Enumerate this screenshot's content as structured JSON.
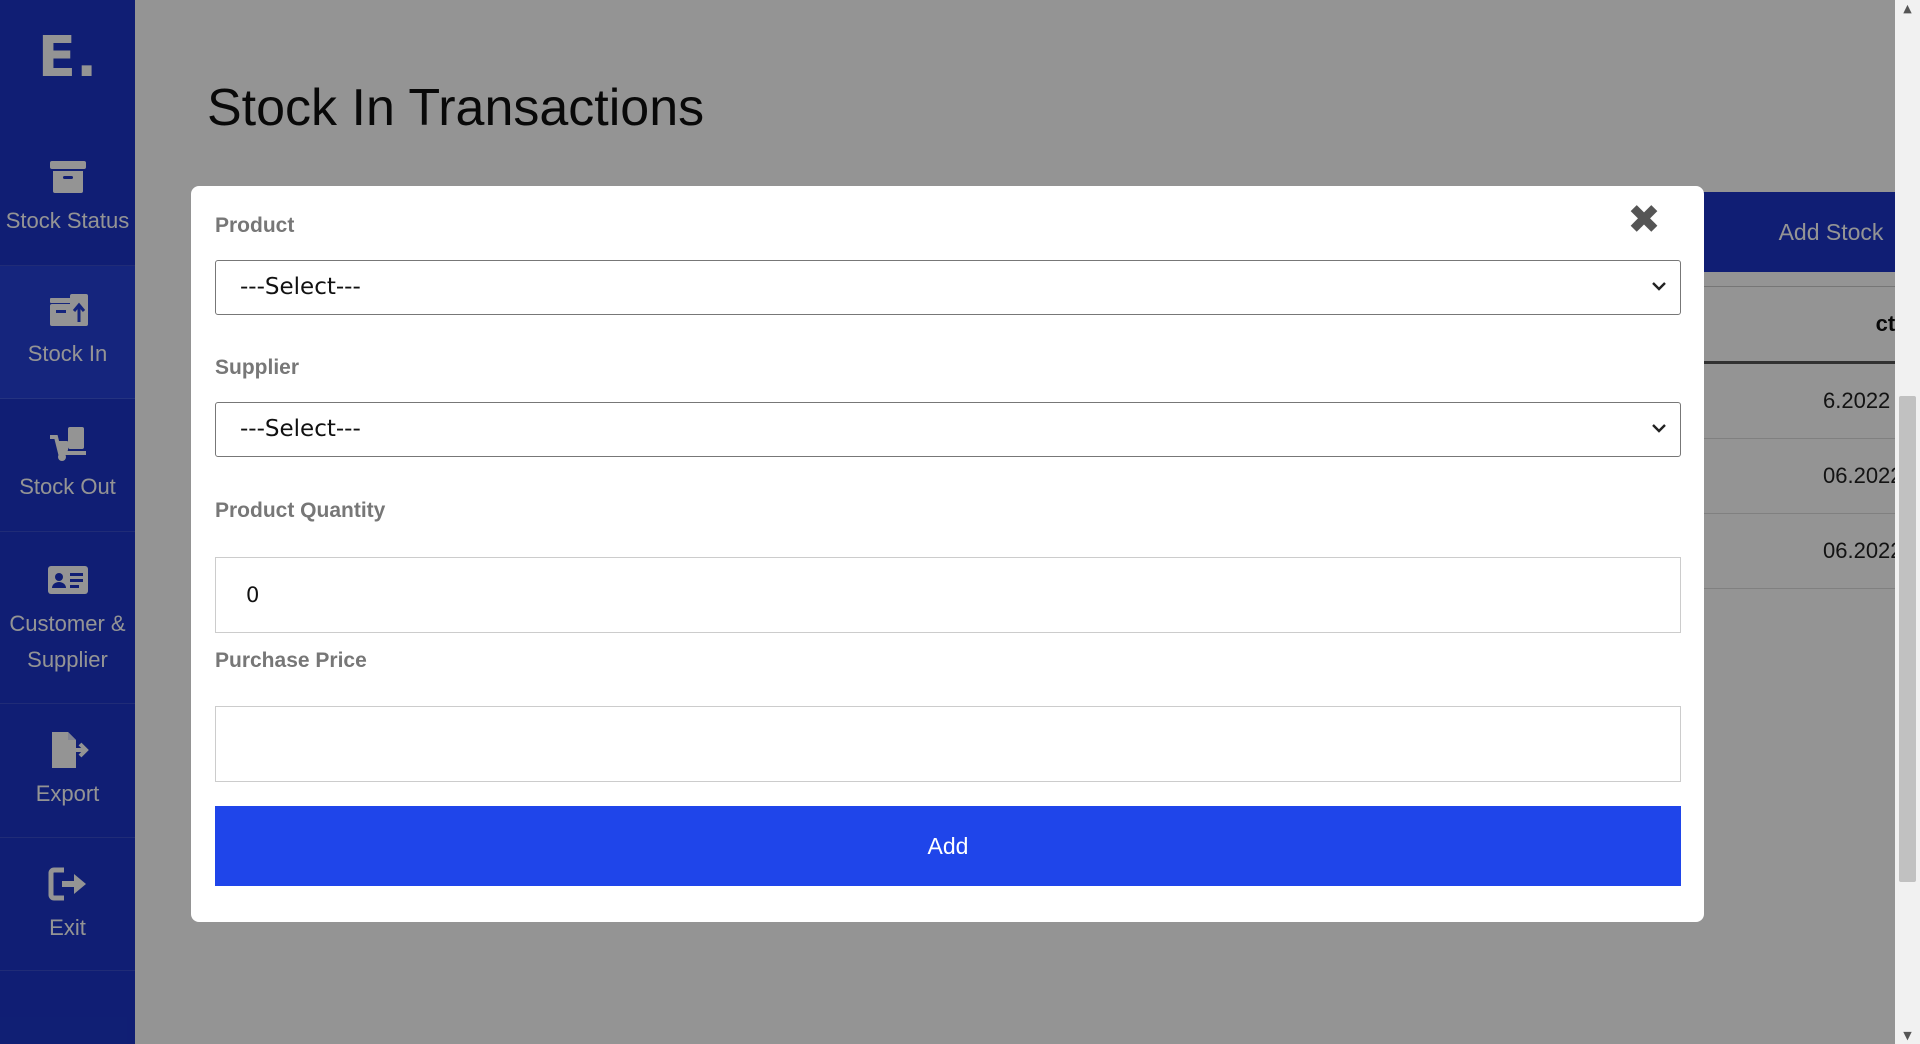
{
  "sidebar": {
    "logo": "E.",
    "items": [
      {
        "label": "Stock Status",
        "icon": "archive-box-icon"
      },
      {
        "label": "Stock In",
        "icon": "box-arrow-up-icon"
      },
      {
        "label": "Stock Out",
        "icon": "hand-truck-icon"
      },
      {
        "label": "Customer &",
        "label2": "Supplier",
        "icon": "id-card-icon"
      },
      {
        "label": "Export",
        "icon": "file-export-icon"
      },
      {
        "label": "Exit",
        "icon": "sign-out-icon"
      }
    ]
  },
  "main": {
    "title": "Stock In Transactions",
    "add_stock_label": "Add Stock",
    "table": {
      "header_partial": "ction Date",
      "rows": [
        "6.2022",
        "06.2022",
        "06.2022"
      ]
    }
  },
  "modal": {
    "close_glyph": "✖",
    "product_label": "Product",
    "product_value": "---Select---",
    "supplier_label": "Supplier",
    "supplier_value": "---Select---",
    "quantity_label": "Product Quantity",
    "quantity_value": "0",
    "price_label": "Purchase Price",
    "price_value": "",
    "add_label": "Add"
  },
  "colors": {
    "sidebar": "#1c35c8",
    "primary_button": "#1f45ea",
    "overlay": "rgba(0,0,0,0.42)"
  }
}
